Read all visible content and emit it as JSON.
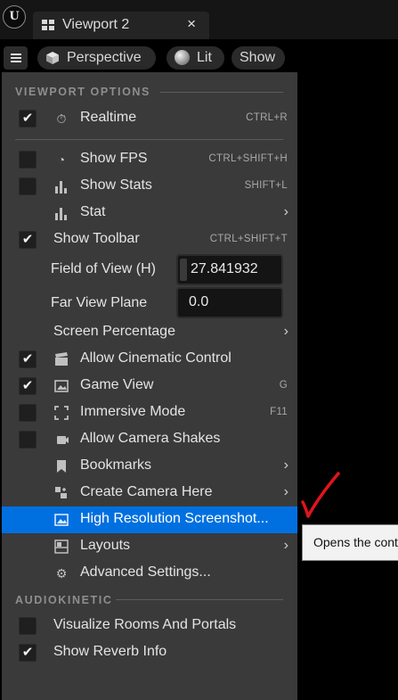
{
  "window": {
    "logo_text": "U",
    "tab_title": "Viewport 2",
    "tab_close": "×"
  },
  "toolbar": {
    "perspective_label": "Perspective",
    "lit_label": "Lit",
    "show_label": "Show"
  },
  "menu": {
    "section_viewport": "VIEWPORT OPTIONS",
    "section_audiokinetic": "AUDIOKINETIC",
    "realtime": {
      "label": "Realtime",
      "shortcut": "CTRL+R",
      "checked": true
    },
    "show_fps": {
      "label": "Show FPS",
      "shortcut": "CTRL+SHIFT+H",
      "checked": false
    },
    "show_stats": {
      "label": "Show Stats",
      "shortcut": "SHIFT+L",
      "checked": false
    },
    "stat": {
      "label": "Stat"
    },
    "show_toolbar": {
      "label": "Show Toolbar",
      "shortcut": "CTRL+SHIFT+T",
      "checked": true
    },
    "field_of_view": {
      "label": "Field of View (H)",
      "value": "27.841932"
    },
    "far_view_plane": {
      "label": "Far View Plane",
      "value": "0.0"
    },
    "screen_percentage": {
      "label": "Screen Percentage"
    },
    "allow_cinematic": {
      "label": "Allow Cinematic Control",
      "checked": true
    },
    "game_view": {
      "label": "Game View",
      "shortcut": "G",
      "checked": true
    },
    "immersive_mode": {
      "label": "Immersive Mode",
      "shortcut": "F11",
      "checked": false
    },
    "allow_camera_shakes": {
      "label": "Allow Camera Shakes",
      "checked": false
    },
    "bookmarks": {
      "label": "Bookmarks"
    },
    "create_camera": {
      "label": "Create Camera Here"
    },
    "high_res_screenshot": {
      "label": "High Resolution Screenshot..."
    },
    "layouts": {
      "label": "Layouts"
    },
    "advanced_settings": {
      "label": "Advanced Settings..."
    },
    "visualize_rooms": {
      "label": "Visualize Rooms And Portals",
      "checked": false
    },
    "show_reverb": {
      "label": "Show Reverb Info",
      "checked": true
    },
    "check_mark": "✔",
    "submenu_arrow": "›"
  },
  "tooltip": {
    "text": "Opens the cont"
  },
  "colors": {
    "highlight": "#0070e0",
    "menu_bg": "#3a3a3a",
    "annotation": "#e0141c"
  },
  "icons": {
    "realtime": "stopwatch-icon",
    "show_fps": "gauge-icon",
    "show_stats": "bar-chart-icon",
    "stat": "bar-chart-icon",
    "allow_cinematic": "clapperboard-icon",
    "game_view": "image-icon",
    "immersive_mode": "fullscreen-icon",
    "allow_camera_shakes": "camera-icon",
    "bookmarks": "bookmark-icon",
    "create_camera": "camera-plus-icon",
    "high_res_screenshot": "screenshot-icon",
    "layouts": "layout-icon",
    "advanced_settings": "gear-icon"
  }
}
